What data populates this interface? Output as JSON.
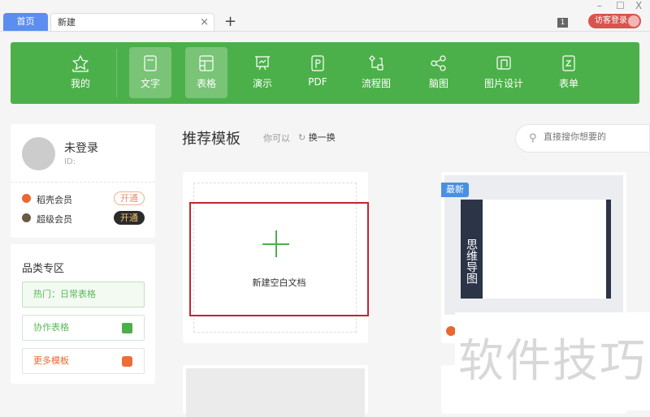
{
  "tabs": {
    "home": "首页",
    "current": "新建",
    "close": "×",
    "add": "+"
  },
  "window": {
    "minimize": "–",
    "maximize": "☐",
    "close": "X",
    "badge": "1",
    "login": "访客登录"
  },
  "toolbar": [
    {
      "label": "我的",
      "icon": "star-icon"
    },
    {
      "label": "文字",
      "icon": "document-icon",
      "active": true
    },
    {
      "label": "表格",
      "icon": "table-icon",
      "active": true
    },
    {
      "label": "演示",
      "icon": "presentation-icon"
    },
    {
      "label": "PDF",
      "icon": "pdf-icon"
    },
    {
      "label": "流程图",
      "icon": "flowchart-icon"
    },
    {
      "label": "脑图",
      "icon": "mindmap-icon"
    },
    {
      "label": "图片设计",
      "icon": "image-design-icon"
    },
    {
      "label": "表单",
      "icon": "form-icon"
    }
  ],
  "user": {
    "name": "未登录",
    "id": "ID:",
    "members": [
      {
        "label": "稻壳会员",
        "button": "开通"
      },
      {
        "label": "超级会员",
        "button": "开通"
      }
    ]
  },
  "category": {
    "title": "品类专区",
    "items": [
      "热门：日常表格",
      "协作表格",
      "更多模板"
    ]
  },
  "main": {
    "title": "推荐模板",
    "hint": "你可以",
    "refresh": "换一换",
    "search_placeholder": "直接搜你想要的",
    "new_blank": "新建空白文档",
    "new_badge": "最新",
    "mindmap_title": "思维导图"
  },
  "watermark": "软件技巧",
  "colors": {
    "accent": "#4cb04a",
    "tab_home": "#5b8ef0",
    "login": "#d9534f",
    "highlight": "#c0272d"
  }
}
